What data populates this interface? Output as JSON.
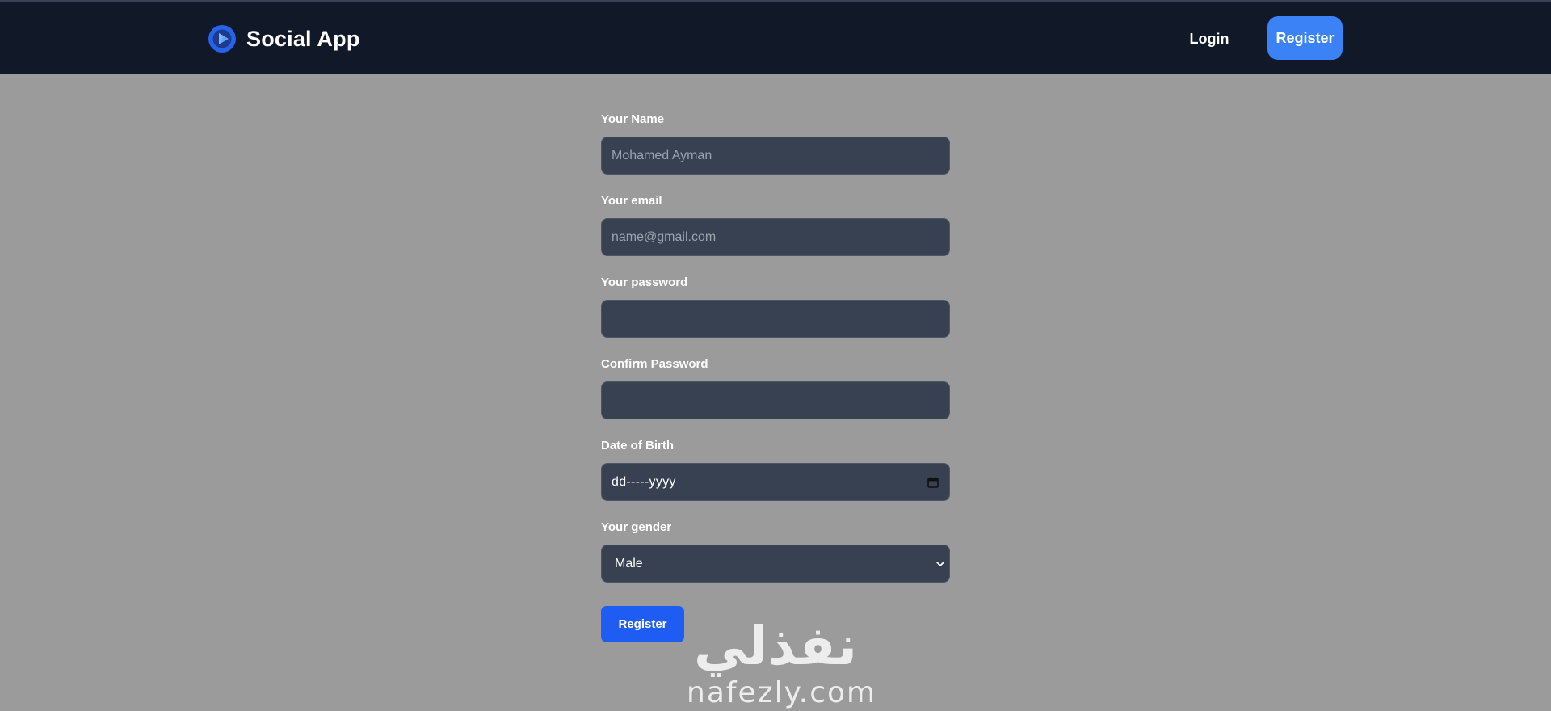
{
  "navbar": {
    "brand": "Social App",
    "brand_logo_icon": "play-circle-logo-icon",
    "login_label": "Login",
    "register_label": "Register"
  },
  "form": {
    "name": {
      "label": "Your Name",
      "placeholder": "Mohamed Ayman",
      "value": ""
    },
    "email": {
      "label": "Your email",
      "placeholder": "name@gmail.com",
      "value": ""
    },
    "password": {
      "label": "Your password",
      "value": ""
    },
    "confirm_password": {
      "label": "Confirm Password",
      "value": ""
    },
    "dob": {
      "label": "Date of Birth",
      "display": "dd-----yyyy",
      "icon": "calendar-icon"
    },
    "gender": {
      "label": "Your gender",
      "selected": "Male",
      "icon": "chevron-down-icon"
    },
    "submit_label": "Register"
  },
  "watermark": {
    "arabic": "نفذلي",
    "latin": "nafezly.com"
  },
  "colors": {
    "navbar_bg": "#111827",
    "page_bg": "#9b9b9b",
    "input_bg": "#374151",
    "nav_register_bg": "#3b82f6",
    "submit_bg": "#1f5cf3"
  }
}
